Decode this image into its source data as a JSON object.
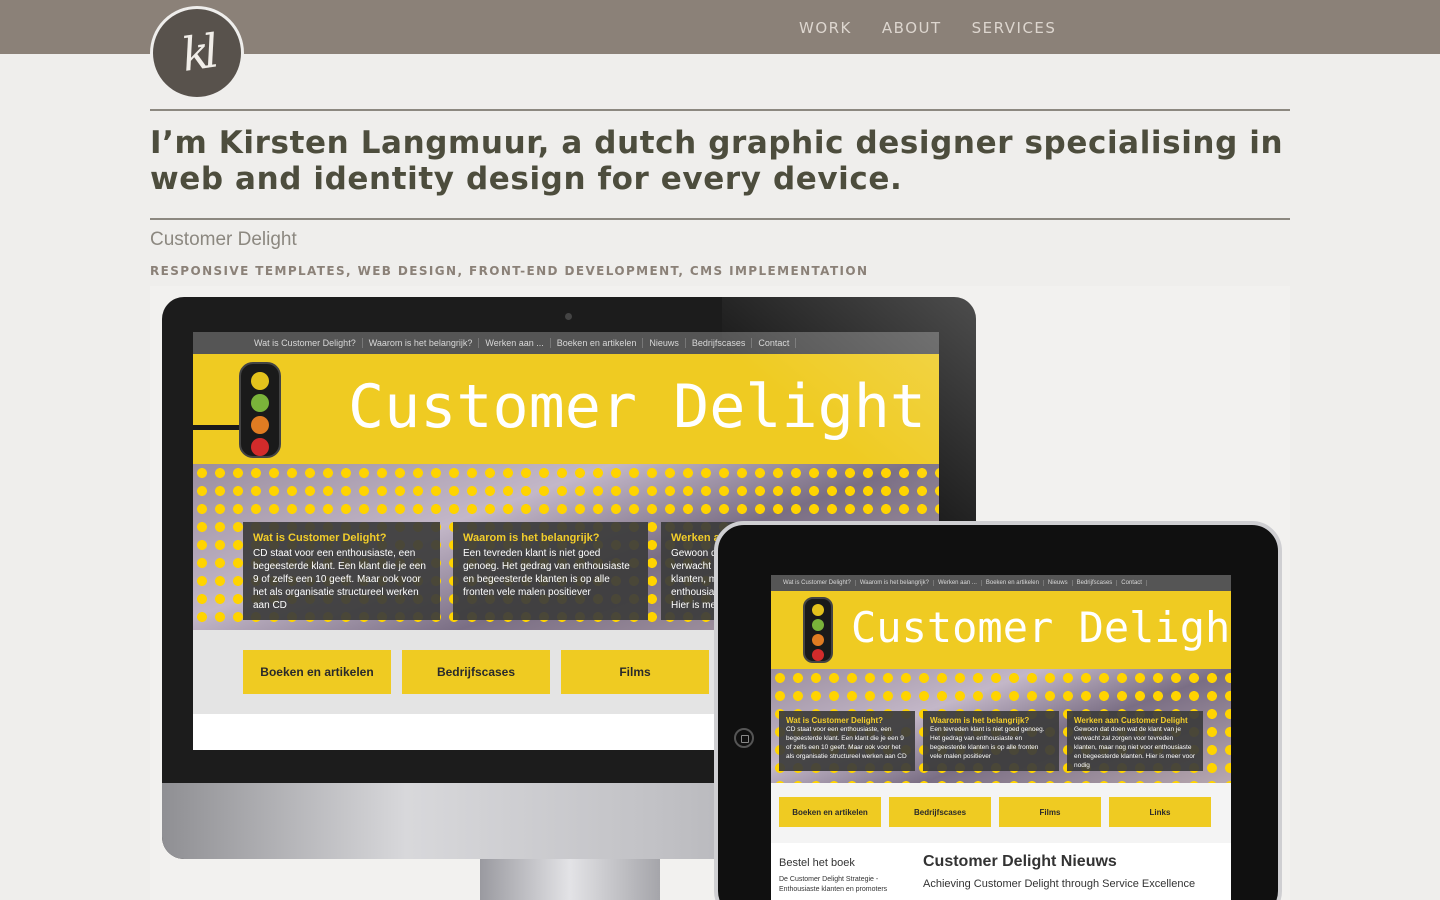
{
  "header": {
    "logo_text": "kl",
    "nav": [
      "WORK",
      "ABOUT",
      "SERVICES"
    ]
  },
  "intro": "I’m Kirsten Langmuur, a dutch graphic designer specialising in web and identity design for every device.",
  "project": {
    "title": "Customer Delight",
    "tags": "RESPONSIVE TEMPLATES, WEB DESIGN, FRONT-END DEVELOPMENT, CMS IMPLEMENTATION"
  },
  "mockup": {
    "nav": [
      "Wat is Customer Delight?",
      "Waarom is het belangrijk?",
      "Werken aan ...",
      "Boeken en artikelen",
      "Nieuws",
      "Bedrijfscases",
      "Contact"
    ],
    "banner_title": "Customer Delight",
    "cards": [
      {
        "title": "Wat is Customer Delight?",
        "body": "CD staat voor een enthousiaste, een begeesterde klant. Een klant die je een 9 of zelfs een 10 geeft. Maar ook voor het als organisatie structureel werken aan CD"
      },
      {
        "title": "Waarom is het belangrijk?",
        "body": "Een tevreden klant is niet goed genoeg. Het gedrag van enthousiaste en begeesterde klanten is op alle fronten vele malen positiever"
      },
      {
        "title": "Werken aan Customer Delight",
        "body": "Gewoon dat doen wat de klant van je verwacht zal zorgen voor tevreden klanten, maar nog niet voor enthousiaste en begeesterde klanten. Hier is meer voor nodig"
      }
    ],
    "buttons_desktop": [
      "Boeken en artikelen",
      "Bedrijfscases",
      "Films"
    ],
    "buttons_tablet": [
      "Boeken en artikelen",
      "Bedrijfscases",
      "Films",
      "Links"
    ],
    "book_heading": "Bestel het boek",
    "book_text": "De Customer Delight Strategie - Enthousiaste klanten en promoters",
    "news_heading": "Customer Delight Nieuws",
    "news_sub": "Achieving Customer Delight through Service Excellence"
  },
  "colors": {
    "topbar": "#8b8178",
    "accent_yellow": "#efcb22",
    "text": "#4d4d3d"
  }
}
